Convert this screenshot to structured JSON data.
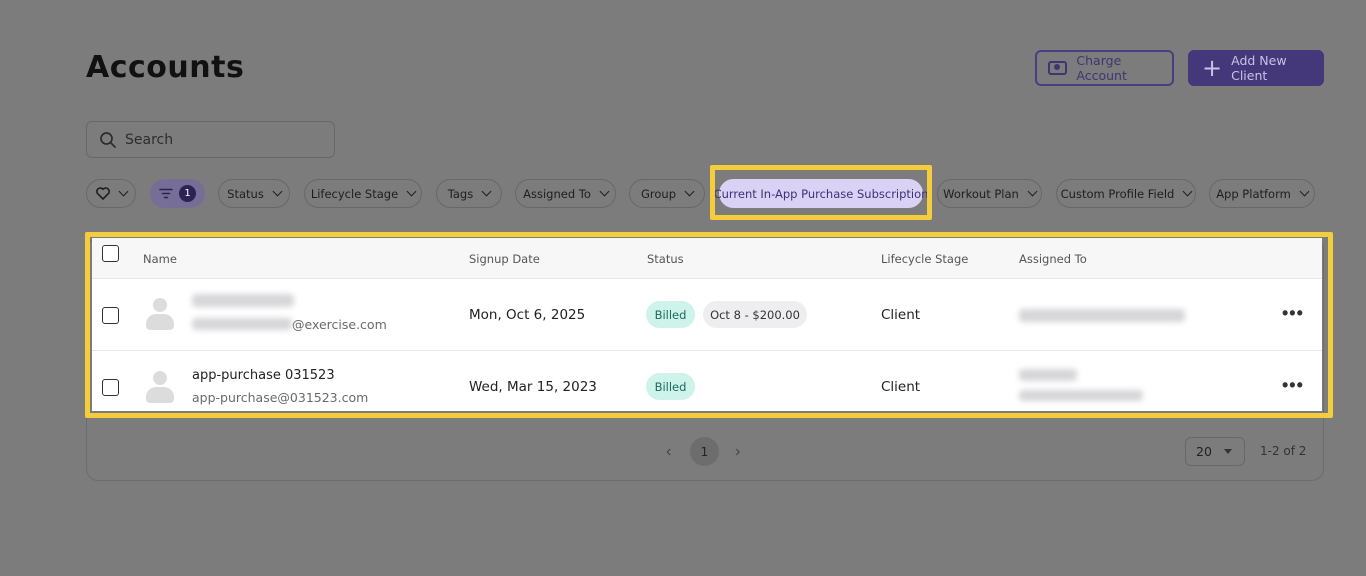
{
  "header": {
    "title": "Accounts",
    "charge_label": "Charge Account",
    "add_label": "Add New Client"
  },
  "search": {
    "placeholder": "Search"
  },
  "filters": {
    "count": "1",
    "chips": [
      "Status",
      "Lifecycle Stage",
      "Tags",
      "Assigned To",
      "Group",
      "Current In-App Purchase Subscription",
      "Workout Plan",
      "Custom Profile Field",
      "App Platform"
    ]
  },
  "table": {
    "columns": [
      "Name",
      "Signup Date",
      "Status",
      "Lifecycle Stage",
      "Assigned To"
    ],
    "rows": [
      {
        "name": "",
        "email": "@exercise.com",
        "signup_date": "Mon, Oct 6, 2025",
        "status": "Billed",
        "renewal": "Oct 8 - $200.00",
        "lifecycle": "Client",
        "more": "•••"
      },
      {
        "name": "app-purchase 031523",
        "email": "app-purchase@031523.com",
        "signup_date": "Wed, Mar 15, 2023",
        "status": "Billed",
        "lifecycle": "Client",
        "more": "•••"
      }
    ]
  },
  "pagination": {
    "prev": "‹",
    "page": "1",
    "next": "›",
    "per_page": "20",
    "range": "1-2 of 2"
  },
  "colors": {
    "accent": "#44377a",
    "highlight": "#f4cd3c",
    "billed_bg": "#cdf3ea"
  }
}
